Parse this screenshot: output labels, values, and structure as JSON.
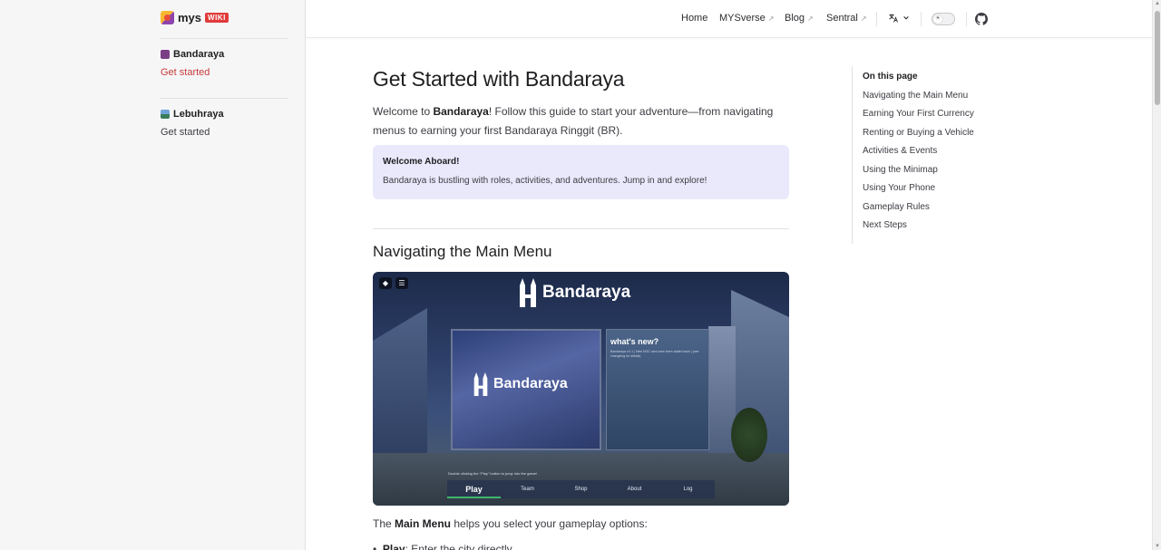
{
  "logo": {
    "text": "mys",
    "badge": "WIKI"
  },
  "sidebar": {
    "groups": [
      {
        "title": "Bandaraya",
        "color": "#7a3e86",
        "links": [
          {
            "label": "Get started",
            "active": true
          }
        ]
      },
      {
        "title": "Lebuhraya",
        "color": "#3a7b5c",
        "links": [
          {
            "label": "Get started",
            "active": false
          }
        ]
      }
    ]
  },
  "nav": {
    "items": [
      {
        "label": "Home",
        "external": false
      },
      {
        "label": "MYSverse",
        "external": true
      },
      {
        "label": "Blog",
        "external": true
      },
      {
        "label": "Sentral",
        "external": true
      }
    ],
    "external_glyph": "↗",
    "language_icon": "translate-icon",
    "theme_icon": "sun-icon",
    "github_icon": "github-icon"
  },
  "page": {
    "title": "Get Started with Bandaraya",
    "intro_before": "Welcome to ",
    "intro_bold": "Bandaraya",
    "intro_after": "! Follow this guide to start your adventure—from navigating menus to earning your first Bandaraya Ringgit (BR).",
    "callout_title": "Welcome Aboard!",
    "callout_text": "Bandaraya is bustling with roles, activities, and adventures. Jump in and explore!",
    "section_title": "Navigating the Main Menu",
    "caption_before": "The ",
    "caption_bold": "Main Menu",
    "caption_after": " helps you select your gameplay options:",
    "bullet_bold": "Play",
    "bullet_text": ": Enter the city directly"
  },
  "screenshot": {
    "brand": "Bandaraya",
    "panel_title": "what's new?",
    "panel_text": "Bandaraya v.0.1 | New NOC cars have been added back | (see changelog for details)",
    "hint": "Double clicking the \"Play\" button to jump into the game!",
    "menu": [
      "Play",
      "Team",
      "Shop",
      "About",
      "Log"
    ]
  },
  "toc": {
    "title": "On this page",
    "items": [
      "Navigating the Main Menu",
      "Earning Your First Currency",
      "Renting or Buying a Vehicle",
      "Activities & Events",
      "Using the Minimap",
      "Using Your Phone",
      "Gameplay Rules",
      "Next Steps"
    ]
  }
}
